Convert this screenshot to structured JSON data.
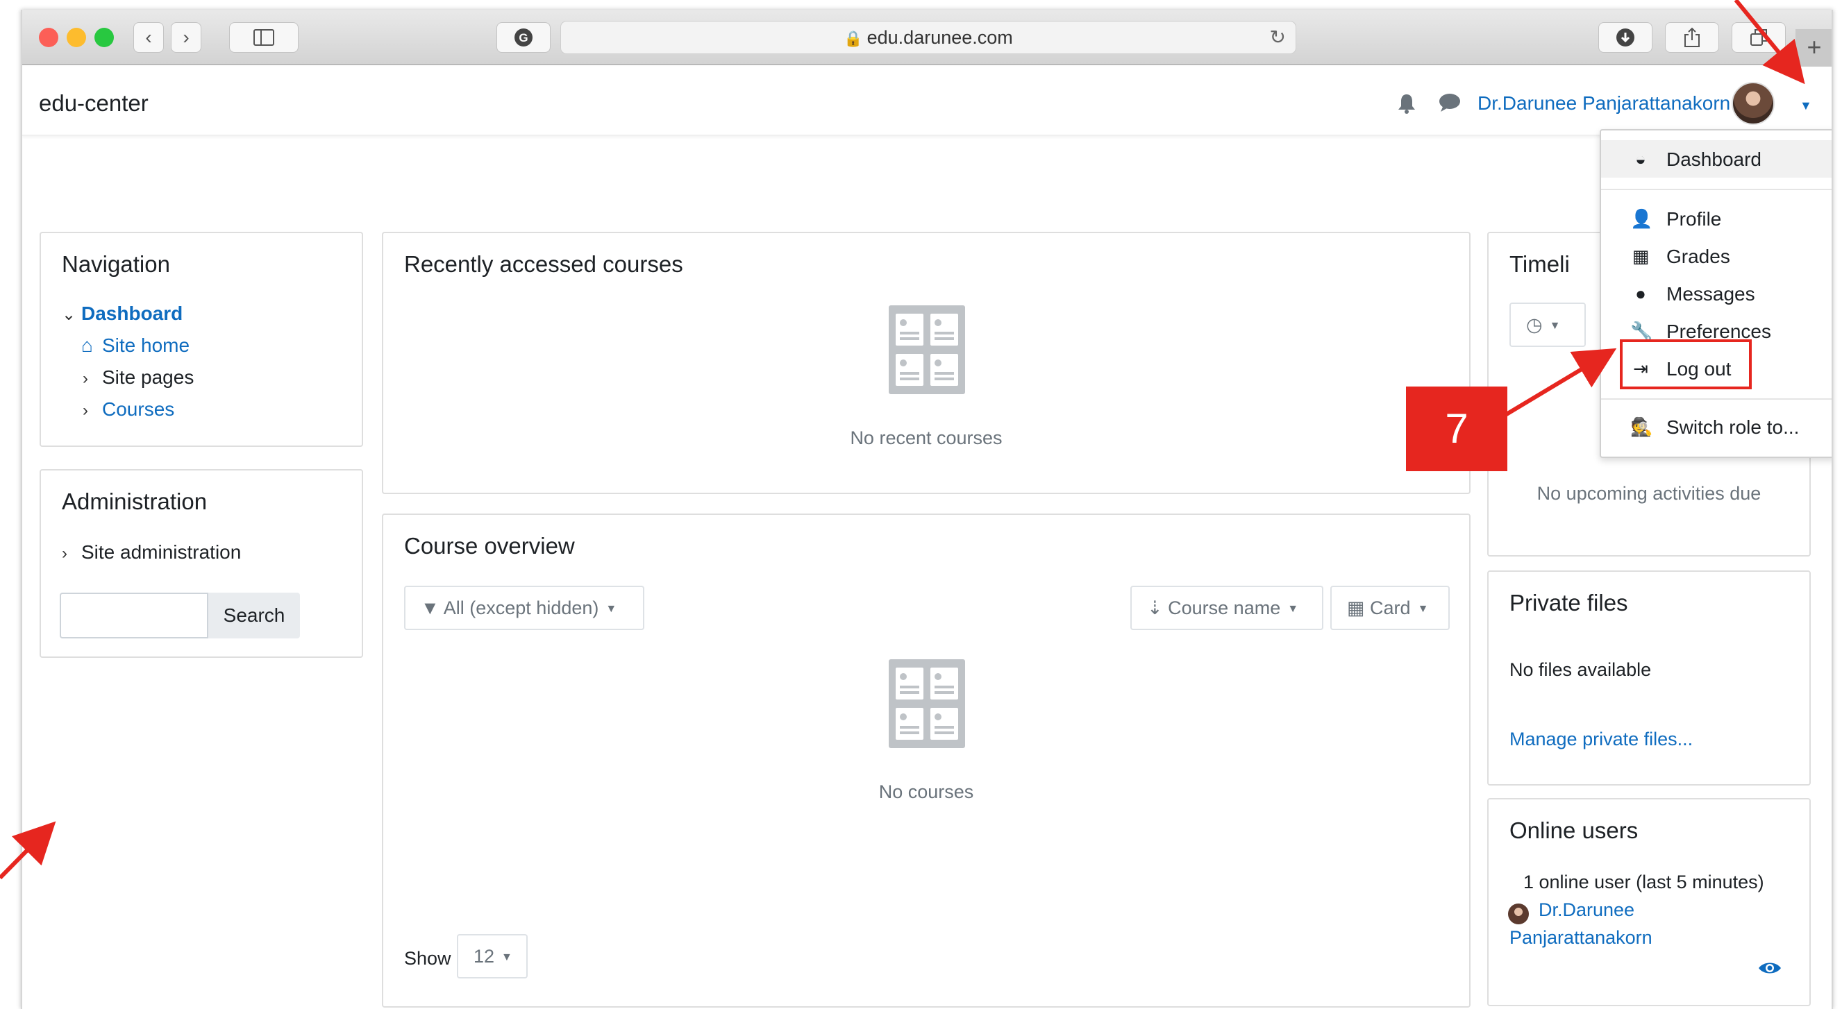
{
  "browser": {
    "url": "edu.darunee.com",
    "icons": {
      "back": "chevron-left-icon",
      "forward": "chevron-right-icon",
      "sidebar": "sidebar-icon",
      "grammarly": "grammarly-icon",
      "reload": "reload-icon",
      "download": "download-icon",
      "share": "share-icon",
      "tabs": "tabs-icon",
      "newtab": "plus-icon"
    }
  },
  "header": {
    "brand": "edu-center",
    "user_name": "Dr.Darunee Panjarattanakorn",
    "link_color": "#0f6cbf"
  },
  "navigation": {
    "title": "Navigation",
    "items": [
      {
        "label": "Dashboard"
      },
      {
        "label": "Site home"
      },
      {
        "label": "Site pages"
      },
      {
        "label": "Courses"
      }
    ]
  },
  "administration": {
    "title": "Administration",
    "site_admin": "Site administration",
    "search_button": "Search",
    "search_value": ""
  },
  "recent": {
    "title": "Recently accessed courses",
    "empty_text": "No recent courses"
  },
  "overview": {
    "title": "Course overview",
    "filter_label": "All (except hidden)",
    "sort_label": "Course name",
    "view_label": "Card",
    "empty_text": "No courses",
    "show_label": "Show",
    "show_value": "12"
  },
  "timeline": {
    "title": "Timeli",
    "empty_text": "No upcoming activities due"
  },
  "private_files": {
    "title": "Private files",
    "empty_text": "No files available",
    "manage_link": "Manage private files..."
  },
  "online_users": {
    "title": "Online users",
    "summary": "1 online user (last 5 minutes)",
    "user_line1": "Dr.Darunee",
    "user_line2": "Panjarattanakorn"
  },
  "user_menu": {
    "items": [
      {
        "label": "Dashboard",
        "icon": "dashboard-icon"
      },
      {
        "label": "Profile",
        "icon": "user-icon"
      },
      {
        "label": "Grades",
        "icon": "table-icon"
      },
      {
        "label": "Messages",
        "icon": "comment-icon"
      },
      {
        "label": "Preferences",
        "icon": "wrench-icon"
      },
      {
        "label": "Log out",
        "icon": "sign-out-icon"
      },
      {
        "label": "Switch role to...",
        "icon": "user-secret-icon"
      }
    ]
  },
  "annotation": {
    "step": "7",
    "color": "#e6261f"
  }
}
